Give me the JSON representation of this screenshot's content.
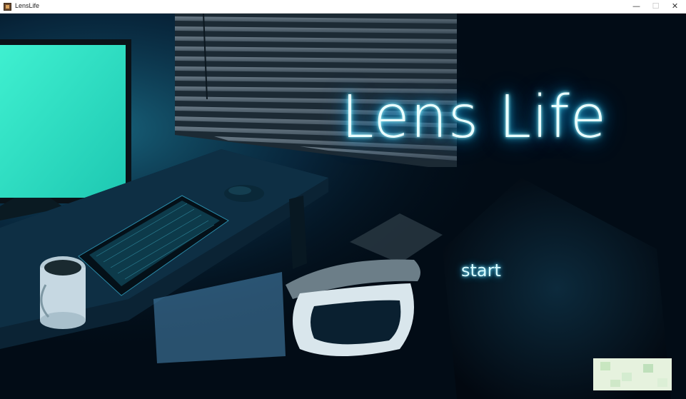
{
  "window": {
    "title": "LensLife",
    "min_glyph": "—",
    "max_glyph": "☐",
    "close_glyph": "✕"
  },
  "scene": {
    "game_title": "Lens Life",
    "start_label": "start"
  },
  "colors": {
    "neon": "#38d9ff",
    "monitor": "#2ee8c8",
    "background": "#02111c"
  }
}
